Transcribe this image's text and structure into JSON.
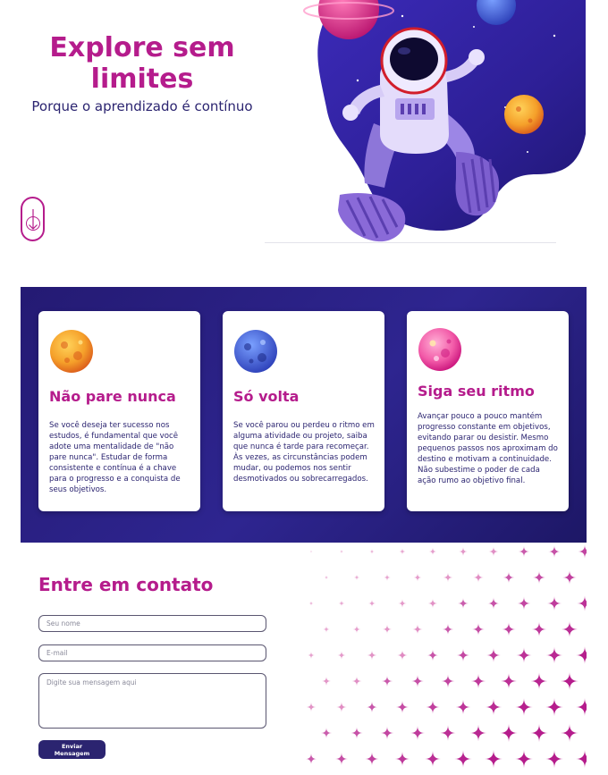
{
  "hero": {
    "title": "Explore sem limites",
    "subtitle": "Porque o aprendizado é contínuo",
    "scroll_icon": "arrow-down-icon",
    "illustration": "astronaut-illustration"
  },
  "features": [
    {
      "icon": "orange-planet-icon",
      "title": "Não pare nunca",
      "text": "Se você deseja ter sucesso nos estudos, é fundamental que você adote uma mentalidade de \"não pare nunca\". Estudar de forma consistente e contínua é a chave para o progresso e a conquista de seus objetivos."
    },
    {
      "icon": "blue-planet-icon",
      "title": "Só volta",
      "text": "Se você parou ou perdeu o ritmo em alguma atividade ou projeto, saiba que nunca é tarde para recomeçar. Às vezes, as circunstâncias podem mudar, ou podemos nos sentir desmotivados ou sobrecarregados."
    },
    {
      "icon": "pink-planet-icon",
      "title": "Siga seu ritmo",
      "text": "Avançar pouco a pouco mantém progresso constante em objetivos, evitando parar ou desistir. Mesmo pequenos passos nos aproximam do destino e motivam a continuidade. Não subestime o poder de cada ação rumo ao objetivo final."
    }
  ],
  "contact": {
    "title": "Entre em contato",
    "name_placeholder": "Seu nome",
    "email_placeholder": "E-mail",
    "message_placeholder": "Digite sua mensagem aqui",
    "submit_label": "Enviar Mensagem"
  },
  "colors": {
    "accent": "#b51c8c",
    "navy": "#2b2470",
    "section_bg": "#241a73"
  }
}
